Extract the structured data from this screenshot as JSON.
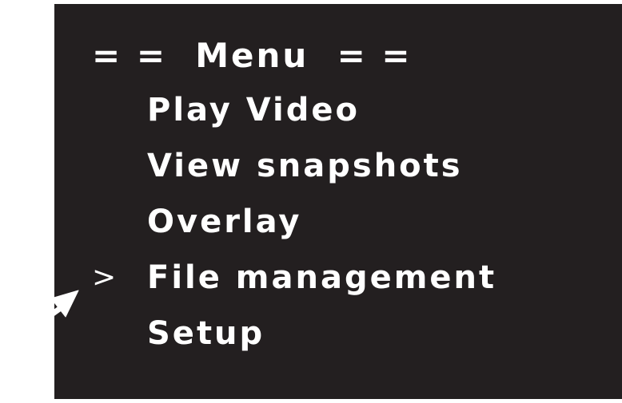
{
  "menu": {
    "title": "= =  Menu  = =",
    "selected_index": 3,
    "cursor_glyph": ">",
    "items": [
      {
        "label": "Play Video",
        "selected": false
      },
      {
        "label": "View snapshots",
        "selected": false
      },
      {
        "label": "Overlay",
        "selected": false
      },
      {
        "label": "File management",
        "selected": true
      },
      {
        "label": "Setup",
        "selected": false
      }
    ]
  },
  "colors": {
    "screen_background": "#231f20",
    "text": "#ffffff",
    "page_background": "#ffffff",
    "arrow": "#ffffff"
  },
  "annotation": {
    "icon": "pointer-arrow-icon"
  }
}
